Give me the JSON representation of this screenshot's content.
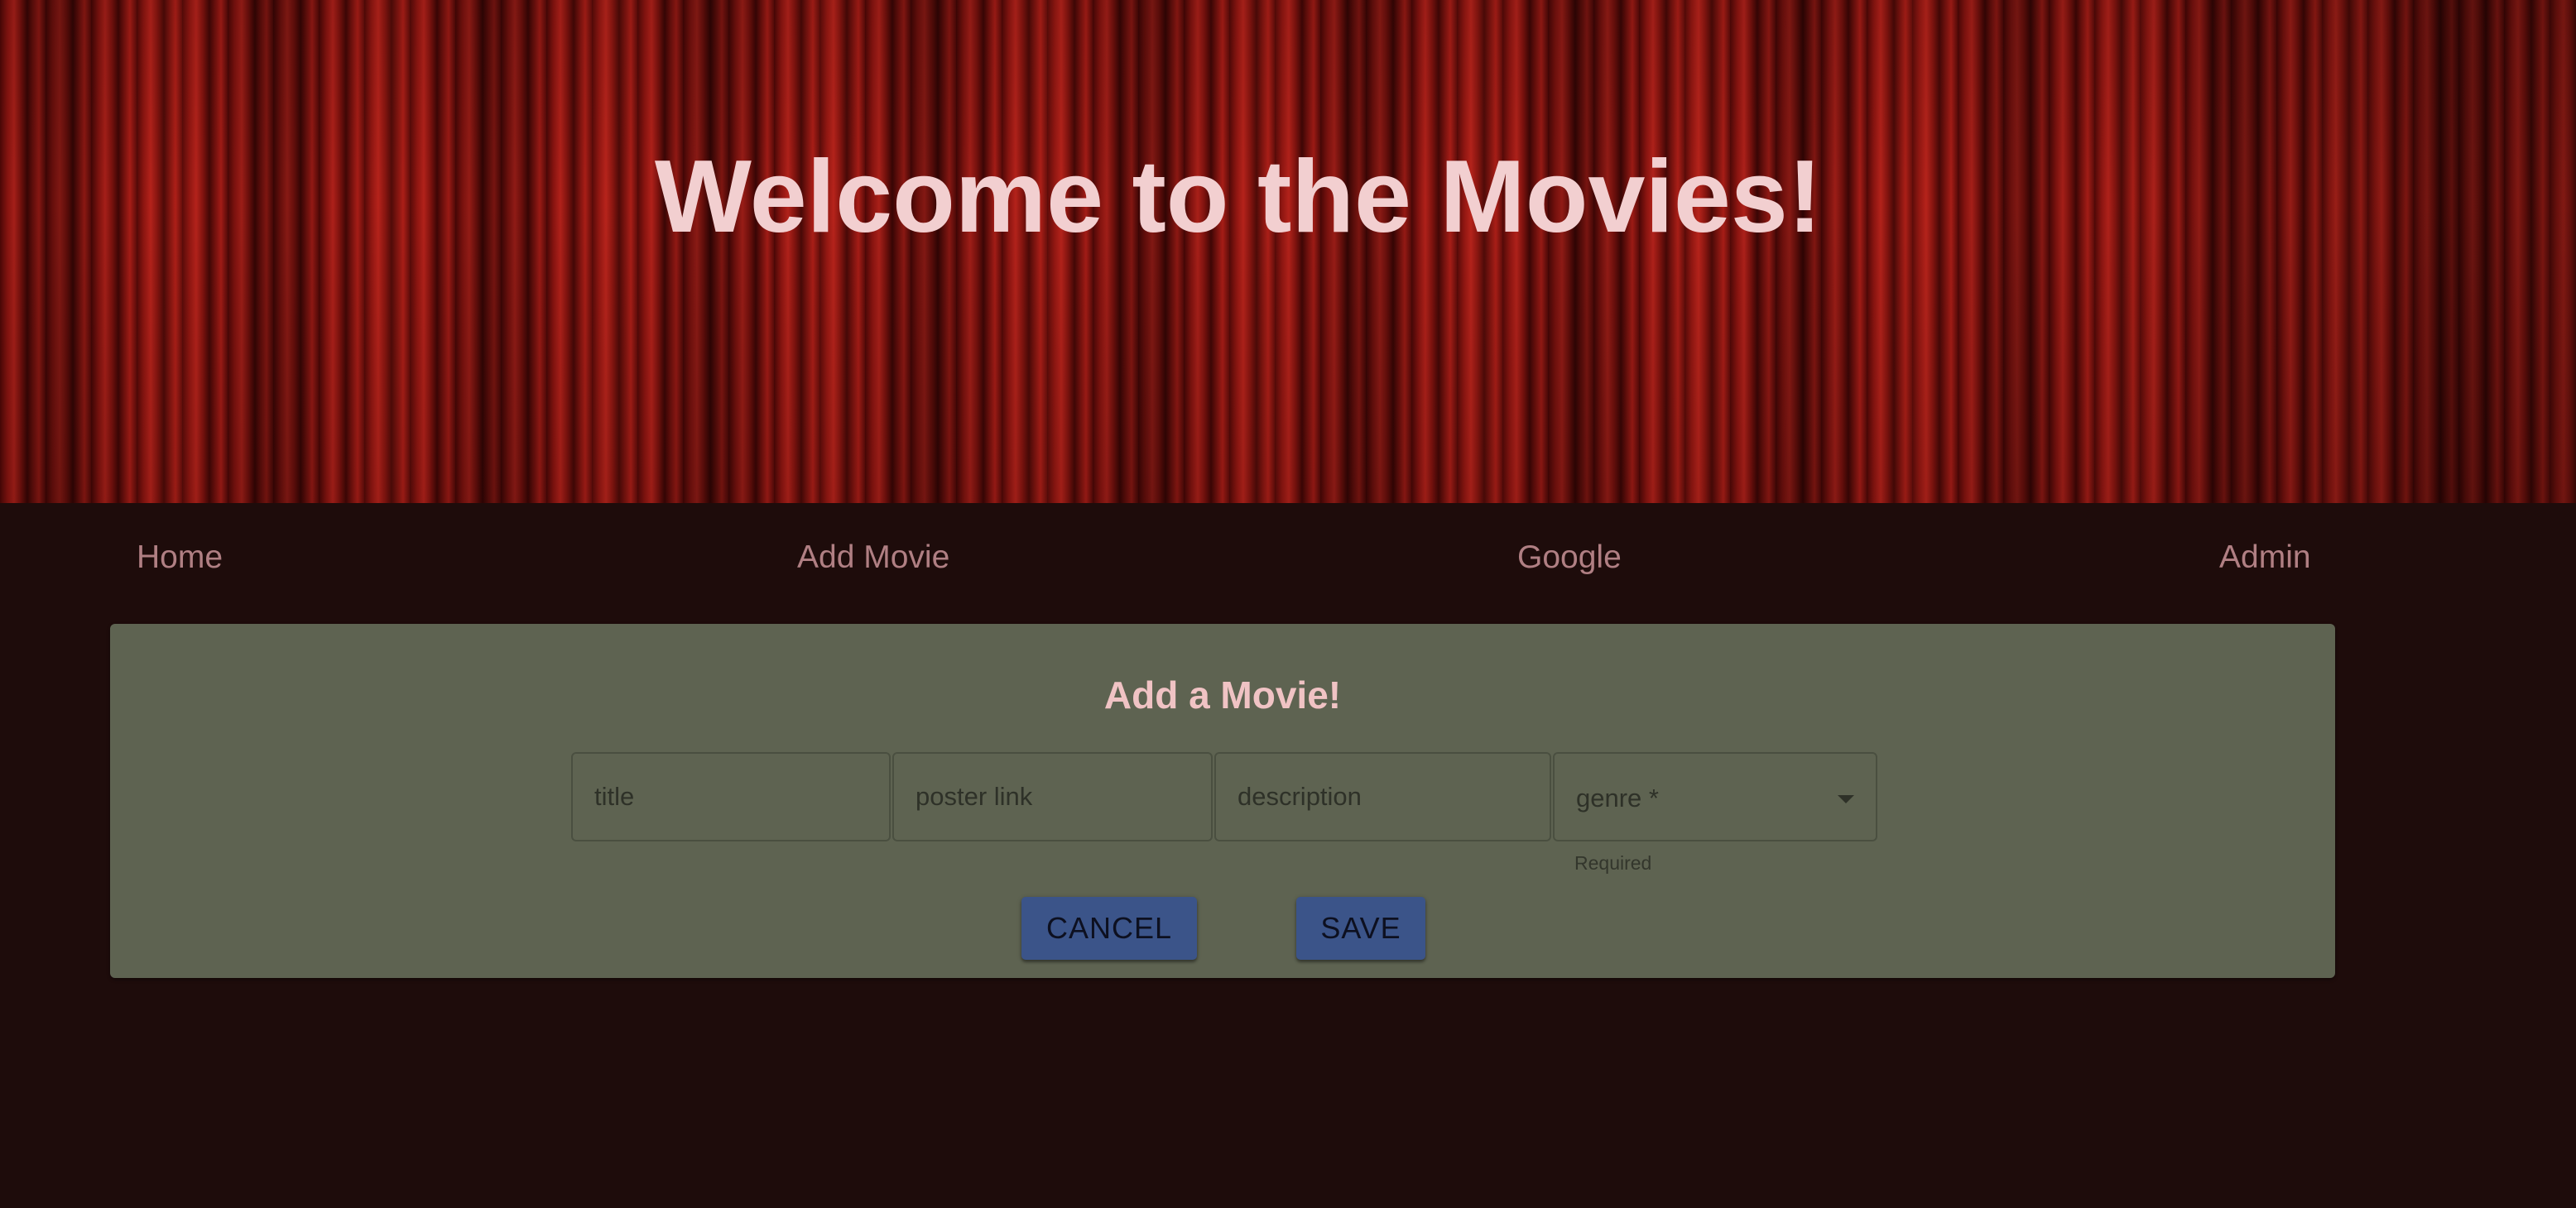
{
  "header": {
    "title": "Welcome to the Movies!"
  },
  "nav": {
    "items": [
      {
        "label": "Home"
      },
      {
        "label": "Add Movie"
      },
      {
        "label": "Google"
      },
      {
        "label": "Admin"
      }
    ]
  },
  "form": {
    "heading": "Add a Movie!",
    "fields": {
      "title": {
        "placeholder": "title",
        "value": ""
      },
      "poster": {
        "placeholder": "poster link",
        "value": ""
      },
      "description": {
        "placeholder": "description",
        "value": ""
      },
      "genre": {
        "label": "genre *",
        "value": "",
        "helper": "Required"
      }
    },
    "buttons": {
      "cancel": "CANCEL",
      "save": "SAVE"
    }
  },
  "icons": {
    "genre_dropdown": "chevron-down-icon"
  },
  "colors": {
    "page_background": "#1e0c0b",
    "title_text": "#f2cfd0",
    "nav_link": "#b07f83",
    "panel_background": "#5e6351",
    "panel_heading": "#f0c3c4",
    "button_background": "#3b5489"
  }
}
